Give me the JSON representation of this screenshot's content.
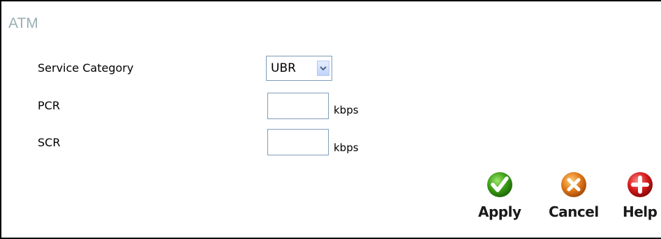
{
  "section": {
    "title": "ATM"
  },
  "form": {
    "service_category": {
      "label": "Service Category",
      "value": "UBR"
    },
    "pcr": {
      "label": "PCR",
      "value": "",
      "unit": "kbps"
    },
    "scr": {
      "label": "SCR",
      "value": "",
      "unit": "kbps"
    }
  },
  "buttons": {
    "apply": {
      "label": "Apply",
      "icon": "check-icon",
      "color": "#3a9a14"
    },
    "cancel": {
      "label": "Cancel",
      "icon": "x-icon",
      "color": "#e07818"
    },
    "help": {
      "label": "Help",
      "icon": "plus-icon",
      "color": "#d41a1a"
    }
  }
}
